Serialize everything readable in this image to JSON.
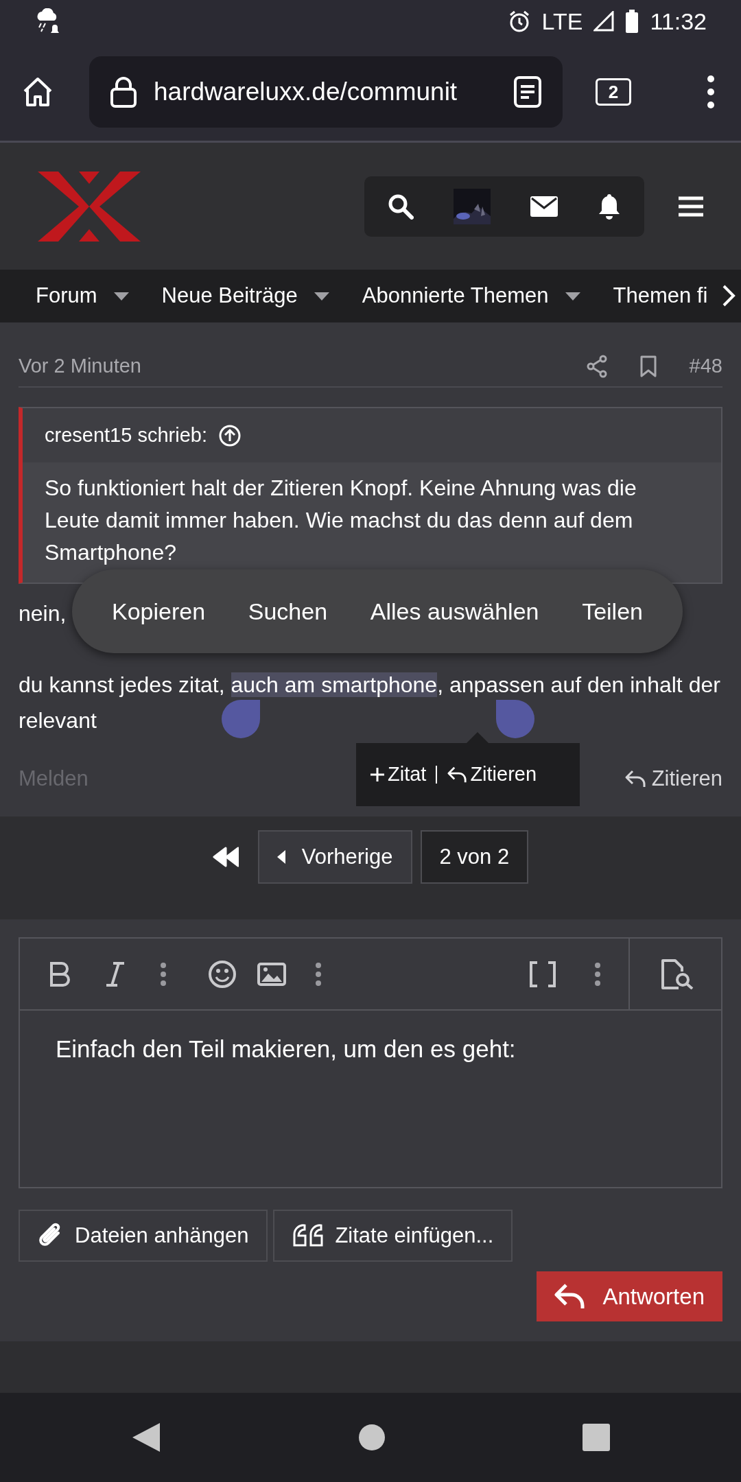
{
  "status_bar": {
    "network": "LTE",
    "time": "11:32"
  },
  "browser": {
    "url": "hardwareluxx.de/communit",
    "tab_count": "2"
  },
  "site_nav": [
    {
      "label": "Forum",
      "has_menu": true
    },
    {
      "label": "Neue Beiträge",
      "has_menu": true
    },
    {
      "label": "Abonnierte Themen",
      "has_menu": true
    },
    {
      "label": "Themen fi",
      "has_menu": false
    }
  ],
  "post": {
    "time": "Vor 2 Minuten",
    "number": "#48",
    "quote": {
      "author": "cresent15 schrieb:",
      "text": "So funktioniert halt der Zitieren Knopf. Keine Ahnung was die Leute damit immer haben. Wie machst du das denn auf dem Smartphone?"
    },
    "first_line": "nein,",
    "paragraph": {
      "before": "du kannst jedes zitat, ",
      "selected": "auch am smartphone",
      "after": ", anpassen auf den inhalt der relevant"
    },
    "actions": [
      {
        "label": "Melden",
        "kind": "report"
      },
      {
        "label": "Zitieren",
        "kind": "reply"
      }
    ]
  },
  "selection_menu": [
    "Kopieren",
    "Suchen",
    "Alles auswählen",
    "Teilen"
  ],
  "quote_tooltip": {
    "add": "Zitat",
    "quote": "Zitieren"
  },
  "pagination": {
    "previous": "Vorherige",
    "page": "2 von 2"
  },
  "editor": {
    "value": "Einfach den Teil makieren, um den es geht:"
  },
  "editor_buttons": [
    {
      "label": "Dateien anhängen",
      "kind": "attach"
    },
    {
      "label": "Zitate einfügen...",
      "kind": "quotes"
    }
  ],
  "submit": "Antworten"
}
